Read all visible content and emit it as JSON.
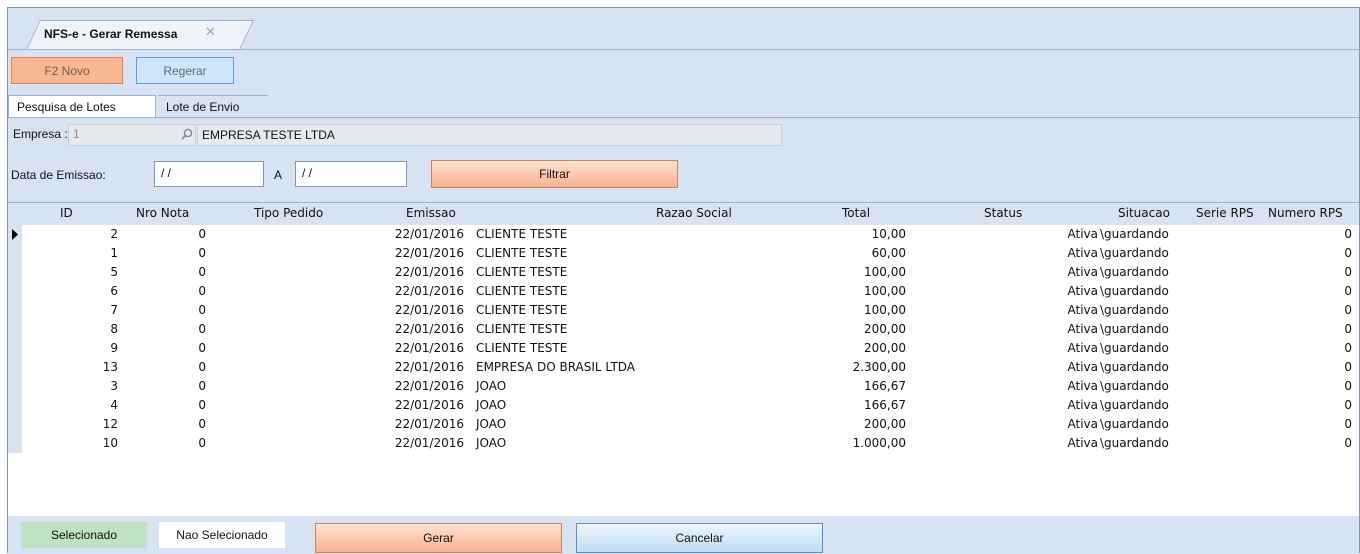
{
  "window_tab": {
    "title": "NFS-e - Gerar Remessa",
    "close": "✕"
  },
  "toolbar": {
    "novo_label": "F2 Novo",
    "regerar_label": "Regerar"
  },
  "tabs": [
    {
      "label": "Pesquisa de Lotes"
    },
    {
      "label": "Lote de Envio"
    }
  ],
  "form": {
    "empresa_label": "Empresa :",
    "empresa_code": "1",
    "empresa_name": "EMPRESA TESTE LTDA",
    "data_label": "Data de Emissao:",
    "date_from": " / /",
    "a_label": "A",
    "date_to": " / /",
    "filter_label": "Filtrar"
  },
  "grid": {
    "columns": [
      "ID",
      "Nro Nota",
      "Tipo Pedido",
      "Emissao",
      "Razao Social",
      "Total",
      "Status",
      "Situacao",
      "Serie RPS",
      "Numero RPS"
    ],
    "rows": [
      {
        "id": "2",
        "nro": "0",
        "tipo": "",
        "emissao": "22/01/2016",
        "razao": "CLIENTE TESTE",
        "total": "10,00",
        "status": "",
        "situacao": "Ativa",
        "situacao2": "\\guardando",
        "serie": "",
        "numero": "0"
      },
      {
        "id": "1",
        "nro": "0",
        "tipo": "",
        "emissao": "22/01/2016",
        "razao": "CLIENTE TESTE",
        "total": "60,00",
        "status": "",
        "situacao": "Ativa",
        "situacao2": "\\guardando",
        "serie": "",
        "numero": "0"
      },
      {
        "id": "5",
        "nro": "0",
        "tipo": "",
        "emissao": "22/01/2016",
        "razao": "CLIENTE TESTE",
        "total": "100,00",
        "status": "",
        "situacao": "Ativa",
        "situacao2": "\\guardando",
        "serie": "",
        "numero": "0"
      },
      {
        "id": "6",
        "nro": "0",
        "tipo": "",
        "emissao": "22/01/2016",
        "razao": "CLIENTE TESTE",
        "total": "100,00",
        "status": "",
        "situacao": "Ativa",
        "situacao2": "\\guardando",
        "serie": "",
        "numero": "0"
      },
      {
        "id": "7",
        "nro": "0",
        "tipo": "",
        "emissao": "22/01/2016",
        "razao": "CLIENTE TESTE",
        "total": "100,00",
        "status": "",
        "situacao": "Ativa",
        "situacao2": "\\guardando",
        "serie": "",
        "numero": "0"
      },
      {
        "id": "8",
        "nro": "0",
        "tipo": "",
        "emissao": "22/01/2016",
        "razao": "CLIENTE TESTE",
        "total": "200,00",
        "status": "",
        "situacao": "Ativa",
        "situacao2": "\\guardando",
        "serie": "",
        "numero": "0"
      },
      {
        "id": "9",
        "nro": "0",
        "tipo": "",
        "emissao": "22/01/2016",
        "razao": "CLIENTE TESTE",
        "total": "200,00",
        "status": "",
        "situacao": "Ativa",
        "situacao2": "\\guardando",
        "serie": "",
        "numero": "0"
      },
      {
        "id": "13",
        "nro": "0",
        "tipo": "",
        "emissao": "22/01/2016",
        "razao": "EMPRESA DO BRASIL LTDA",
        "total": "2.300,00",
        "status": "",
        "situacao": "Ativa",
        "situacao2": "\\guardando",
        "serie": "",
        "numero": "0"
      },
      {
        "id": "3",
        "nro": "0",
        "tipo": "",
        "emissao": "22/01/2016",
        "razao": "JOAO",
        "total": "166,67",
        "status": "",
        "situacao": "Ativa",
        "situacao2": "\\guardando",
        "serie": "",
        "numero": "0"
      },
      {
        "id": "4",
        "nro": "0",
        "tipo": "",
        "emissao": "22/01/2016",
        "razao": "JOAO",
        "total": "166,67",
        "status": "",
        "situacao": "Ativa",
        "situacao2": "\\guardando",
        "serie": "",
        "numero": "0"
      },
      {
        "id": "12",
        "nro": "0",
        "tipo": "",
        "emissao": "22/01/2016",
        "razao": "JOAO",
        "total": "200,00",
        "status": "",
        "situacao": "Ativa",
        "situacao2": "\\guardando",
        "serie": "",
        "numero": "0"
      },
      {
        "id": "10",
        "nro": "0",
        "tipo": "",
        "emissao": "22/01/2016",
        "razao": "JOAO",
        "total": "1.000,00",
        "status": "",
        "situacao": "Ativa",
        "situacao2": "\\guardando",
        "serie": "",
        "numero": "0"
      }
    ]
  },
  "footer": {
    "legend_selected": "Selecionado",
    "legend_not_selected": "Nao Selecionado",
    "gerar_label": "Gerar",
    "cancelar_label": "Cancelar"
  },
  "colors": {
    "app_bg": "#d7e3f3",
    "accent_orange": "#f9b28e",
    "accent_blue": "#cfe6fa",
    "selected_green": "#bfe2c2"
  },
  "icons": {
    "empresa_search": "search-icon",
    "row_pointer": "row-pointer-icon",
    "tab_close": "close-icon"
  }
}
